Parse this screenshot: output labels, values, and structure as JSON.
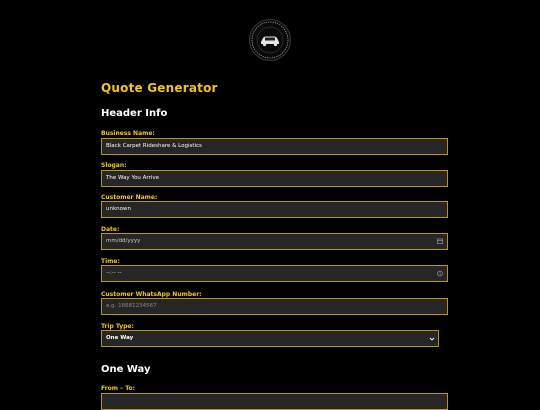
{
  "logo": {
    "ring_text": "BLACK CARPET RIDESHARE & LOGISTICS"
  },
  "page": {
    "title": "Quote Generator"
  },
  "sections": {
    "header_info": "Header Info",
    "one_way": "One Way"
  },
  "fields": {
    "business_name": {
      "label": "Business Name:",
      "value": "Black Carpet Rideshare & Logistics"
    },
    "slogan": {
      "label": "Slogan:",
      "value": "The Way You Arrive"
    },
    "customer_name": {
      "label": "Customer Name:",
      "value": "unknown"
    },
    "date": {
      "label": "Date:",
      "value": "mm/dd/yyyy",
      "icon": "calendar-icon"
    },
    "time": {
      "label": "Time:",
      "value": "--:-- --",
      "icon": "clock-icon"
    },
    "whatsapp": {
      "label": "Customer WhatsApp Number:",
      "placeholder": "e.g. 18681234567"
    },
    "trip_type": {
      "label": "Trip Type:",
      "value": "One Way",
      "icon": "chevron-down-icon"
    },
    "from_to": {
      "label": "From – To:",
      "value": ""
    }
  },
  "colors": {
    "accent": "#f5c518",
    "border": "#b8960f",
    "field_bg": "#262626",
    "page_bg": "#000000"
  }
}
